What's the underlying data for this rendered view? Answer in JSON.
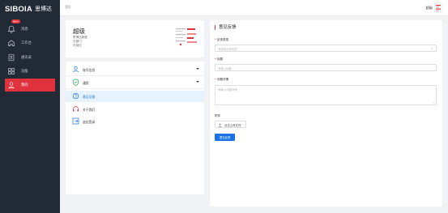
{
  "app": {
    "logo_text": "SIBOIA",
    "logo_cn": "思博达"
  },
  "sidebar": {
    "items": [
      {
        "label": "消息",
        "icon": "bell-icon",
        "badge": "99+"
      },
      {
        "label": "工作台",
        "icon": "home-icon"
      },
      {
        "label": "通讯录",
        "icon": "contacts-icon"
      },
      {
        "label": "功能",
        "icon": "grid-icon"
      },
      {
        "label": "我的",
        "icon": "user-icon",
        "active": true
      }
    ]
  },
  "topbar": {
    "breadcrumb": "我的",
    "username": "超级"
  },
  "profile": {
    "name": "超级",
    "company": "思博达新能",
    "department": "无部门",
    "position": "无岗位"
  },
  "menu": {
    "items": [
      {
        "label": "账号信息",
        "icon": "user-icon",
        "expandable": true
      },
      {
        "label": "通用",
        "icon": "shield-icon",
        "expandable": true
      },
      {
        "label": "意见反馈",
        "icon": "feedback-icon",
        "selected": true
      },
      {
        "label": "关于我们",
        "icon": "info-icon"
      },
      {
        "label": "退出登录",
        "icon": "logout-icon"
      }
    ]
  },
  "form": {
    "title": "意见反馈",
    "type_label": "反馈类型",
    "type_placeholder": "请选择反馈类型",
    "subject_label": "标题",
    "subject_placeholder": "请输入标题",
    "detail_label": "问题详情",
    "detail_placeholder": "请输入问题详情",
    "attachment_label": "附件",
    "upload_label": "点击上传文件",
    "submit_label": "提交反馈"
  },
  "colors": {
    "sidebar_bg": "#222a36",
    "accent_red": "#e0323c",
    "primary_blue": "#1a72e6"
  }
}
